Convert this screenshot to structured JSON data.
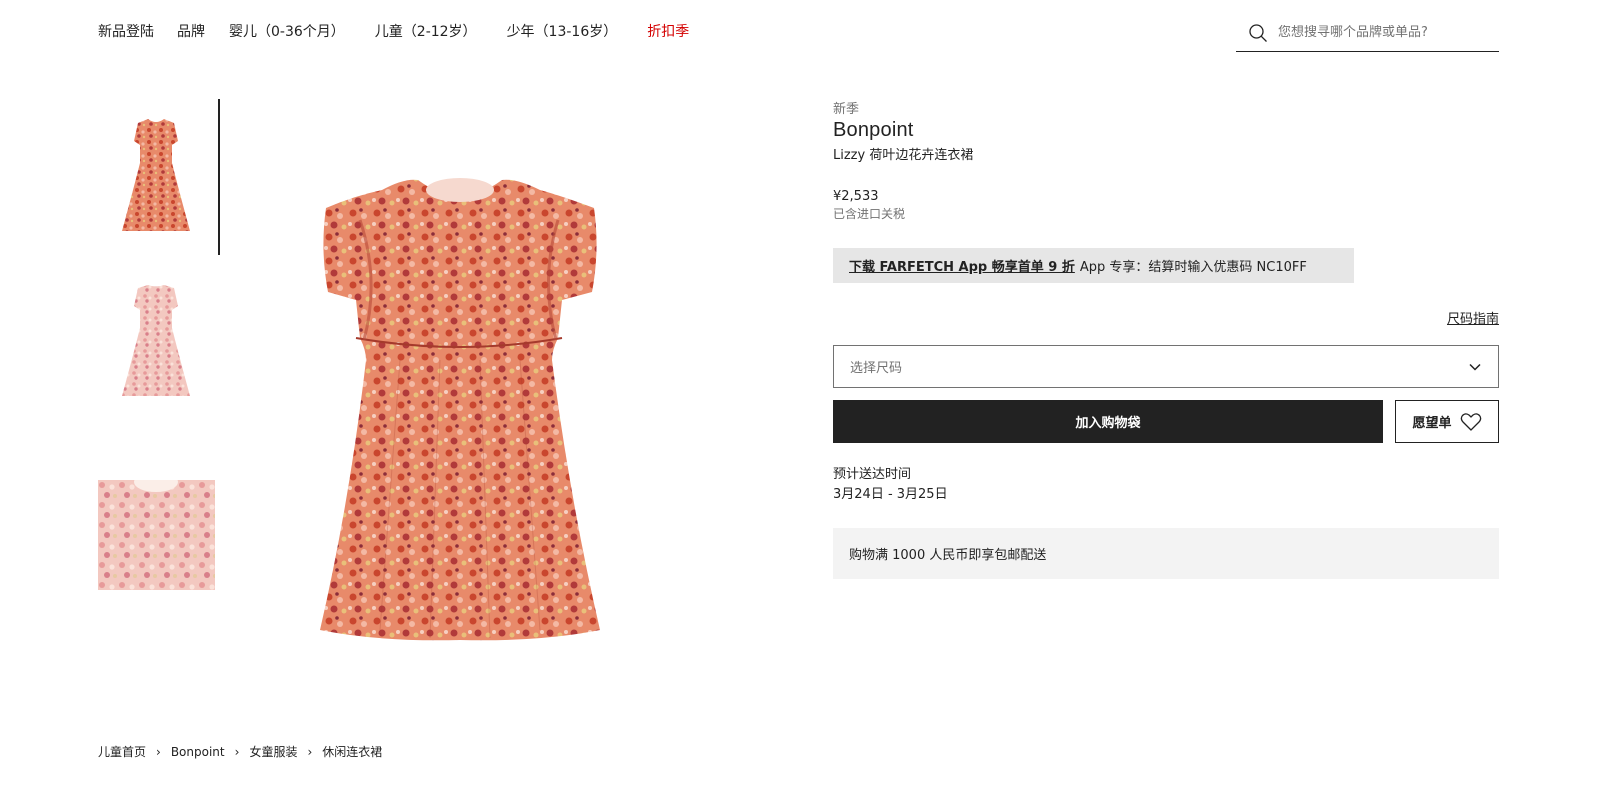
{
  "nav": {
    "items": [
      {
        "label": "新品登陆",
        "sale": false
      },
      {
        "label": "品牌",
        "sale": false
      },
      {
        "label": "婴儿（0-36个月）",
        "sale": false
      },
      {
        "label": "儿童（2-12岁）",
        "sale": false
      },
      {
        "label": "少年（13-16岁）",
        "sale": false
      },
      {
        "label": "折扣季",
        "sale": true
      }
    ]
  },
  "search": {
    "placeholder": "您想搜寻哪个品牌或单品?"
  },
  "product": {
    "season": "新季",
    "brand": "Bonpoint",
    "name": "Lizzy 荷叶边花卉连衣裙",
    "price": "¥2,533",
    "tax_note": "已含进口关税"
  },
  "promo": {
    "link_text": "下载 FARFETCH App 畅享首单 9 折",
    "text": "App 专享：结算时输入优惠码 NC10FF"
  },
  "size": {
    "guide_label": "尺码指南",
    "select_label": "选择尺码"
  },
  "actions": {
    "add_to_bag": "加入购物袋",
    "wishlist": "愿望单"
  },
  "delivery": {
    "label": "预计送达时间",
    "dates": "3月24日 - 3月25日"
  },
  "shipping": {
    "text": "购物满 1000 人民币即享包邮配送"
  },
  "breadcrumb": [
    "儿童首页",
    "Bonpoint",
    "女童服装",
    "休闲连衣裙"
  ],
  "colors": {
    "accent_sale": "#d40000",
    "primary_button": "#222222",
    "promo_bg": "#e6e6e6",
    "shipping_bg": "#f3f3f3"
  }
}
